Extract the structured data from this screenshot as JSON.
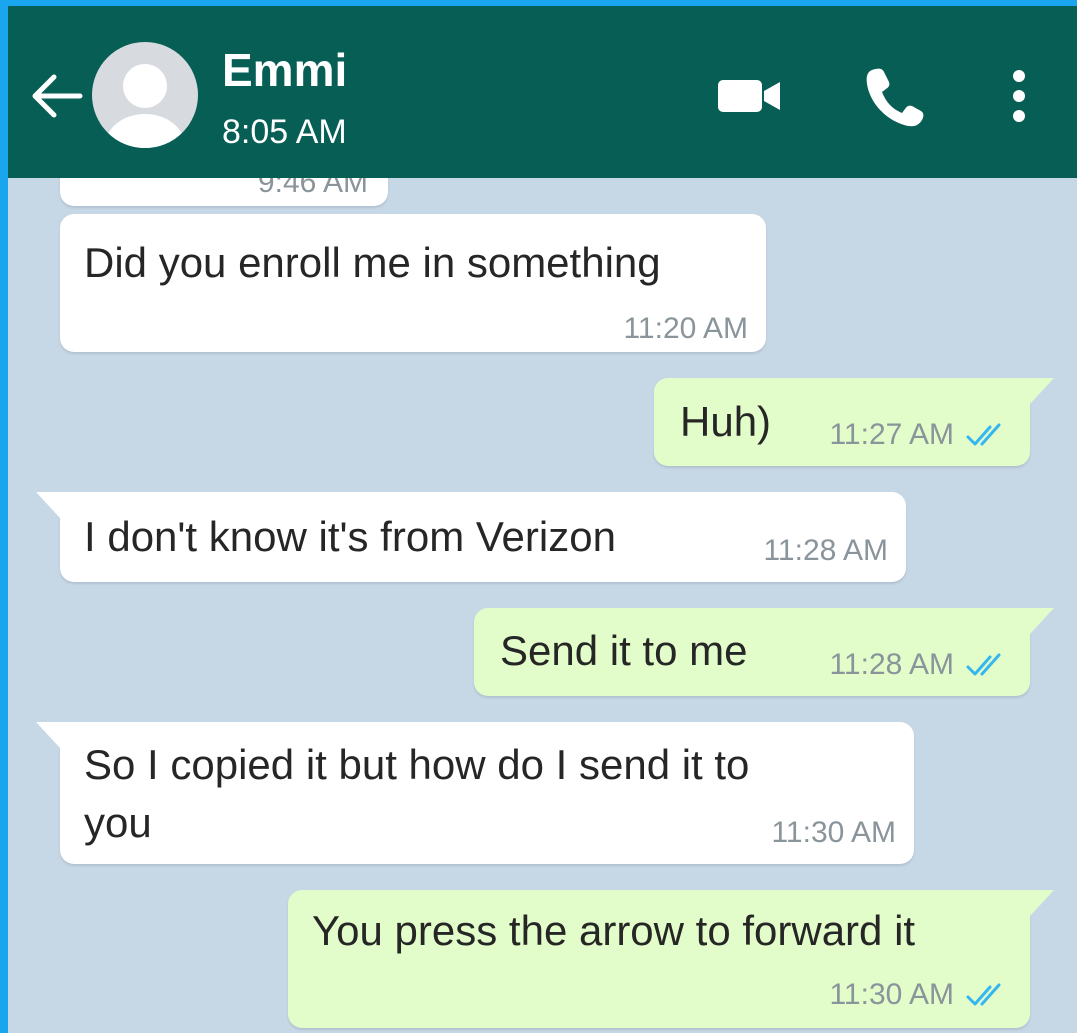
{
  "header": {
    "contact_name": "Emmi",
    "last_seen": "8:05 AM",
    "icons": [
      "back-arrow-icon",
      "avatar",
      "video-call-icon",
      "phone-icon",
      "more-vert-icon"
    ],
    "background_color": "#075e54"
  },
  "chat": {
    "background_color": "#c6d7e6",
    "outgoing_bubble_color": "#e2fdc9",
    "incoming_bubble_color": "#ffffff",
    "read_tick_color": "#34b7f1",
    "partial_prev_time": "9:46 AM",
    "messages": [
      {
        "direction": "incoming",
        "text": "Did you enroll me in something",
        "time": "11:20 AM"
      },
      {
        "direction": "outgoing",
        "text": "Huh)",
        "time": "11:27 AM",
        "status": "read"
      },
      {
        "direction": "incoming",
        "text": "I don't know it's from Verizon",
        "time": "11:28 AM"
      },
      {
        "direction": "outgoing",
        "text": "Send it to me",
        "time": "11:28 AM",
        "status": "read"
      },
      {
        "direction": "incoming",
        "text_line1": "So I copied it but how do I send it to",
        "text_line2": "you",
        "time": "11:30 AM"
      },
      {
        "direction": "outgoing",
        "text": "You press the arrow to forward it",
        "time": "11:30 AM",
        "status": "read"
      }
    ]
  }
}
